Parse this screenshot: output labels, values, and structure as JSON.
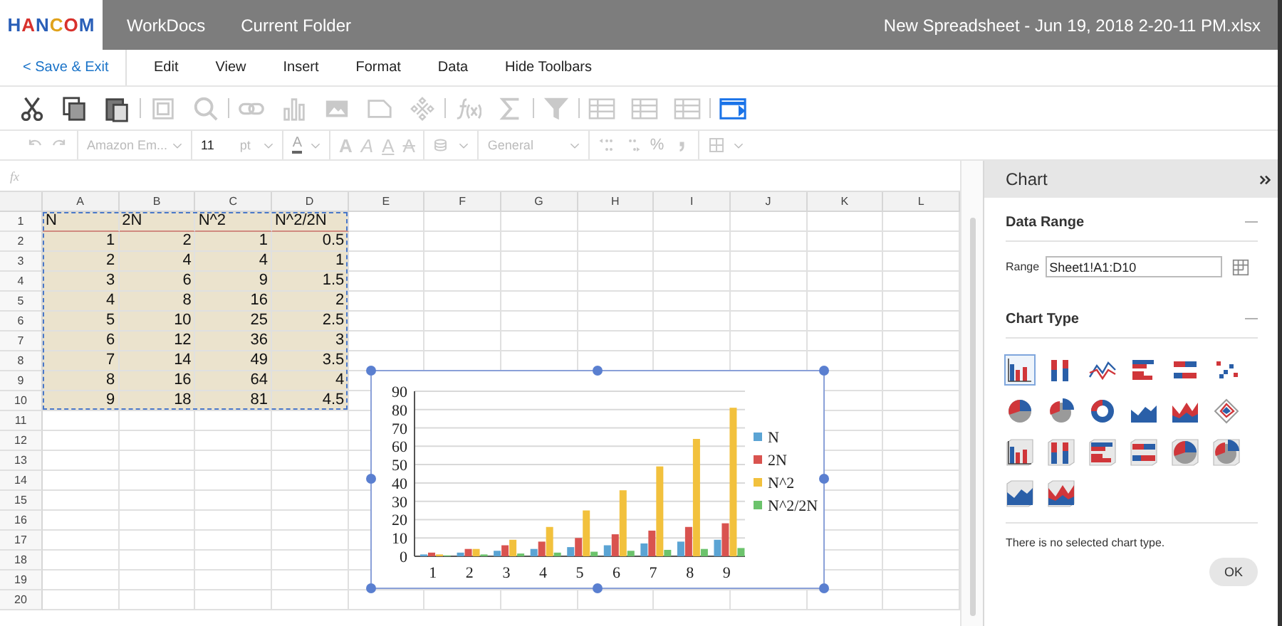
{
  "app_bar": {
    "logo": "HANCOM",
    "tabs": [
      "WorkDocs",
      "Current Folder"
    ],
    "file_name": "New Spreadsheet - Jun 19, 2018 2-20-11 PM.xlsx"
  },
  "menu": {
    "back": "< Save & Exit",
    "items": [
      "Edit",
      "View",
      "Insert",
      "Format",
      "Data",
      "Hide Toolbars"
    ]
  },
  "toolbar": [
    [
      {
        "kind": "cut",
        "disabled": false,
        "active": false
      },
      {
        "kind": "copy",
        "disabled": false,
        "active": false
      },
      {
        "kind": "paste",
        "disabled": false,
        "active": false
      }
    ],
    [
      {
        "kind": "frame",
        "disabled": true,
        "active": false
      },
      {
        "kind": "search",
        "disabled": true,
        "active": false
      }
    ],
    [
      {
        "kind": "link",
        "disabled": true,
        "active": false
      },
      {
        "kind": "chart",
        "disabled": true,
        "active": false
      },
      {
        "kind": "image",
        "disabled": true,
        "active": false
      },
      {
        "kind": "shape",
        "disabled": true,
        "active": false
      },
      {
        "kind": "pattern",
        "disabled": true,
        "active": false
      }
    ],
    [
      {
        "kind": "function",
        "disabled": true,
        "active": false
      },
      {
        "kind": "sum",
        "disabled": true,
        "active": false
      }
    ],
    [
      {
        "kind": "filter",
        "disabled": true,
        "active": false
      }
    ],
    [
      {
        "kind": "table",
        "disabled": true,
        "active": false
      },
      {
        "kind": "table",
        "disabled": true,
        "active": false
      },
      {
        "kind": "table",
        "disabled": true,
        "active": false
      }
    ],
    [
      {
        "kind": "panel",
        "disabled": false,
        "active": true
      }
    ]
  ],
  "format_bar": {
    "font": "Amazon Em...",
    "size": "11",
    "unit": "pt",
    "color_letter": "A",
    "styles": [
      {
        "label": "A",
        "kind": "bold"
      },
      {
        "label": "A",
        "kind": "italic"
      },
      {
        "label": "A",
        "kind": "underline"
      },
      {
        "label": "A",
        "kind": "strike"
      }
    ],
    "number_format": "General",
    "percent": "%"
  },
  "formula_bar": {
    "label": "fx"
  },
  "sheet": {
    "columns": [
      "A",
      "B",
      "C",
      "D",
      "E",
      "F",
      "G",
      "H",
      "I",
      "J",
      "K",
      "L"
    ],
    "rows": [
      {
        "number": "1",
        "kind": "header",
        "in_range": true,
        "cells": [
          "N",
          "2N",
          "N^2",
          "N^2/2N"
        ]
      },
      {
        "number": "2",
        "kind": "values",
        "in_range": true,
        "cells": [
          "1",
          "2",
          "1",
          "0.5"
        ]
      },
      {
        "number": "3",
        "kind": "values",
        "in_range": true,
        "cells": [
          "2",
          "4",
          "4",
          "1"
        ]
      },
      {
        "number": "4",
        "kind": "values",
        "in_range": true,
        "cells": [
          "3",
          "6",
          "9",
          "1.5"
        ]
      },
      {
        "number": "5",
        "kind": "values",
        "in_range": true,
        "cells": [
          "4",
          "8",
          "16",
          "2"
        ]
      },
      {
        "number": "6",
        "kind": "values",
        "in_range": true,
        "cells": [
          "5",
          "10",
          "25",
          "2.5"
        ]
      },
      {
        "number": "7",
        "kind": "values",
        "in_range": true,
        "cells": [
          "6",
          "12",
          "36",
          "3"
        ]
      },
      {
        "number": "8",
        "kind": "values",
        "in_range": true,
        "cells": [
          "7",
          "14",
          "49",
          "3.5"
        ]
      },
      {
        "number": "9",
        "kind": "values",
        "in_range": true,
        "cells": [
          "8",
          "16",
          "64",
          "4"
        ]
      },
      {
        "number": "10",
        "kind": "values",
        "in_range": true,
        "cells": [
          "9",
          "18",
          "81",
          "4.5"
        ]
      },
      {
        "number": "11",
        "in_range": false
      },
      {
        "number": "12",
        "in_range": false
      },
      {
        "number": "13",
        "in_range": false
      },
      {
        "number": "14",
        "in_range": false
      },
      {
        "number": "15",
        "in_range": false
      },
      {
        "number": "16",
        "in_range": false
      },
      {
        "number": "17",
        "in_range": false
      },
      {
        "number": "18",
        "in_range": false
      },
      {
        "number": "19",
        "in_range": false
      },
      {
        "number": "20",
        "in_range": false
      }
    ]
  },
  "chart": {
    "chart_data": {
      "type": "bar",
      "grid": true,
      "legend": "right",
      "categories": [
        "1",
        "2",
        "3",
        "4",
        "5",
        "6",
        "7",
        "8",
        "9"
      ],
      "ylim": [
        0,
        90
      ],
      "yticks": [
        0,
        10,
        20,
        30,
        40,
        50,
        60,
        70,
        80,
        90
      ],
      "series": [
        {
          "name": "N",
          "color": "#5ba4d4",
          "values": [
            1,
            2,
            3,
            4,
            5,
            6,
            7,
            8,
            9
          ]
        },
        {
          "name": "2N",
          "color": "#d9534f",
          "values": [
            2,
            4,
            6,
            8,
            10,
            12,
            14,
            16,
            18
          ]
        },
        {
          "name": "N^2",
          "color": "#f2c13d",
          "values": [
            1,
            4,
            9,
            16,
            25,
            36,
            49,
            64,
            81
          ]
        },
        {
          "name": "N^2/2N",
          "color": "#6cc36c",
          "values": [
            0.5,
            1,
            1.5,
            2,
            2.5,
            3,
            3.5,
            4,
            4.5
          ]
        }
      ]
    }
  },
  "panel": {
    "title": "Chart",
    "data_range": {
      "heading": "Data Range",
      "label": "Range",
      "value": "Sheet1!A1:D10"
    },
    "chart_type": {
      "heading": "Chart Type",
      "types": [
        {
          "kind": "column",
          "selected": true
        },
        {
          "kind": "stacked-column",
          "selected": false
        },
        {
          "kind": "line",
          "selected": false
        },
        {
          "kind": "bar",
          "selected": false
        },
        {
          "kind": "stacked-bar",
          "selected": false
        },
        {
          "kind": "scatter",
          "selected": false
        },
        {
          "kind": "pie",
          "selected": false
        },
        {
          "kind": "pie-exploded",
          "selected": false
        },
        {
          "kind": "donut",
          "selected": false
        },
        {
          "kind": "area",
          "selected": false
        },
        {
          "kind": "stacked-area",
          "selected": false
        },
        {
          "kind": "radar",
          "selected": false
        },
        {
          "kind": "column-3d",
          "selected": false
        },
        {
          "kind": "stacked-column-3d",
          "selected": false
        },
        {
          "kind": "bar-3d",
          "selected": false
        },
        {
          "kind": "stacked-bar-3d",
          "selected": false
        },
        {
          "kind": "pie-3d",
          "selected": false
        },
        {
          "kind": "pie-exploded-3d",
          "selected": false
        },
        {
          "kind": "area-3d",
          "selected": false
        },
        {
          "kind": "stacked-area-3d",
          "selected": false
        }
      ],
      "message": "There is no selected chart type.",
      "button": "OK"
    }
  }
}
